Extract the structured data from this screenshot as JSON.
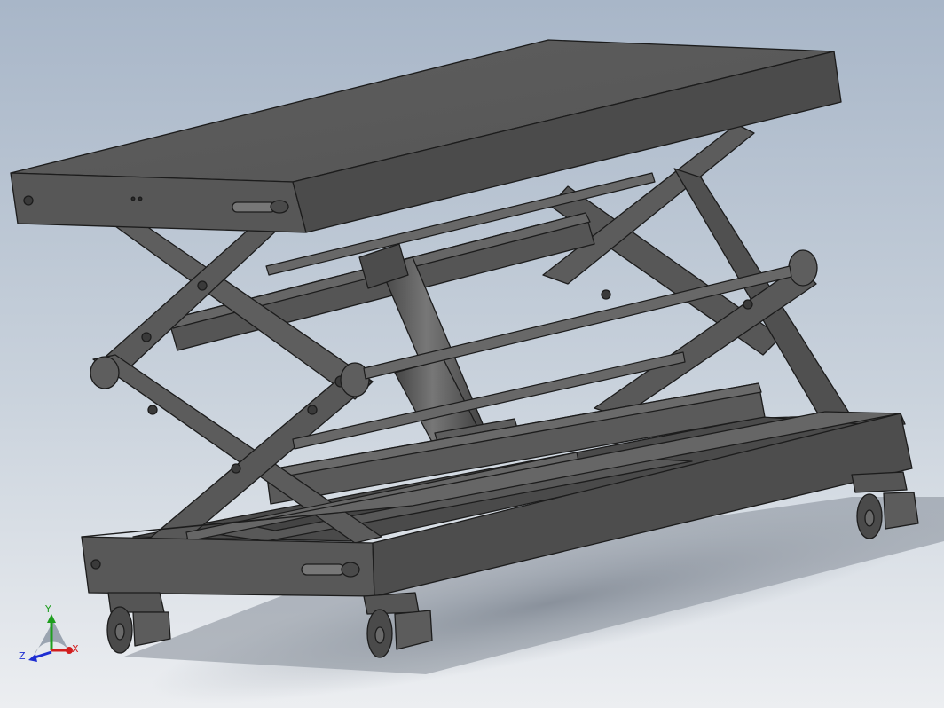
{
  "viewport": {
    "background_top": "#a9b7c9",
    "background_bottom": "#e8ecf0",
    "model_color": "#5a5a5a",
    "model_dark": "#3e3e3e",
    "model_light": "#6d6d6d",
    "edge_color": "#1e1e1e"
  },
  "triad": {
    "y_label": "Y",
    "x_label": "X",
    "z_label": "Z",
    "x_color": "#d21e1e",
    "y_color": "#1e9e1e",
    "z_color": "#1e2ed2"
  }
}
